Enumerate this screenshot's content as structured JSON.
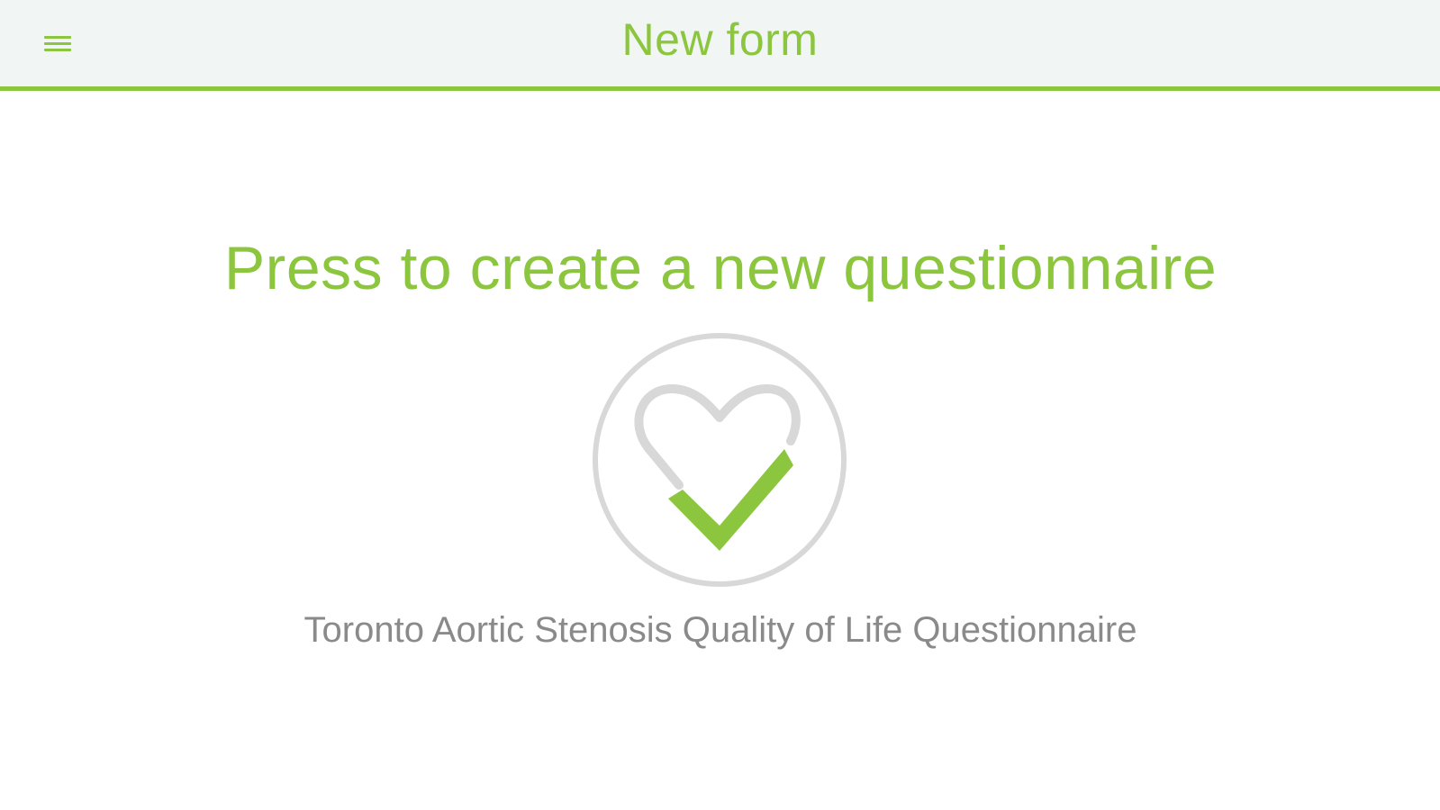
{
  "header": {
    "title": "New form",
    "menu_icon": "hamburger-menu-icon"
  },
  "main": {
    "prompt": "Press to create a new questionnaire",
    "logo_icon": "heart-check-icon",
    "questionnaire_name": "Toronto Aortic Stenosis Quality of Life Questionnaire"
  },
  "colors": {
    "accent": "#8cc63f",
    "header_background": "#f1f5f4",
    "logo_ring": "#d8d8d8",
    "secondary_text": "#8a8a8a"
  }
}
